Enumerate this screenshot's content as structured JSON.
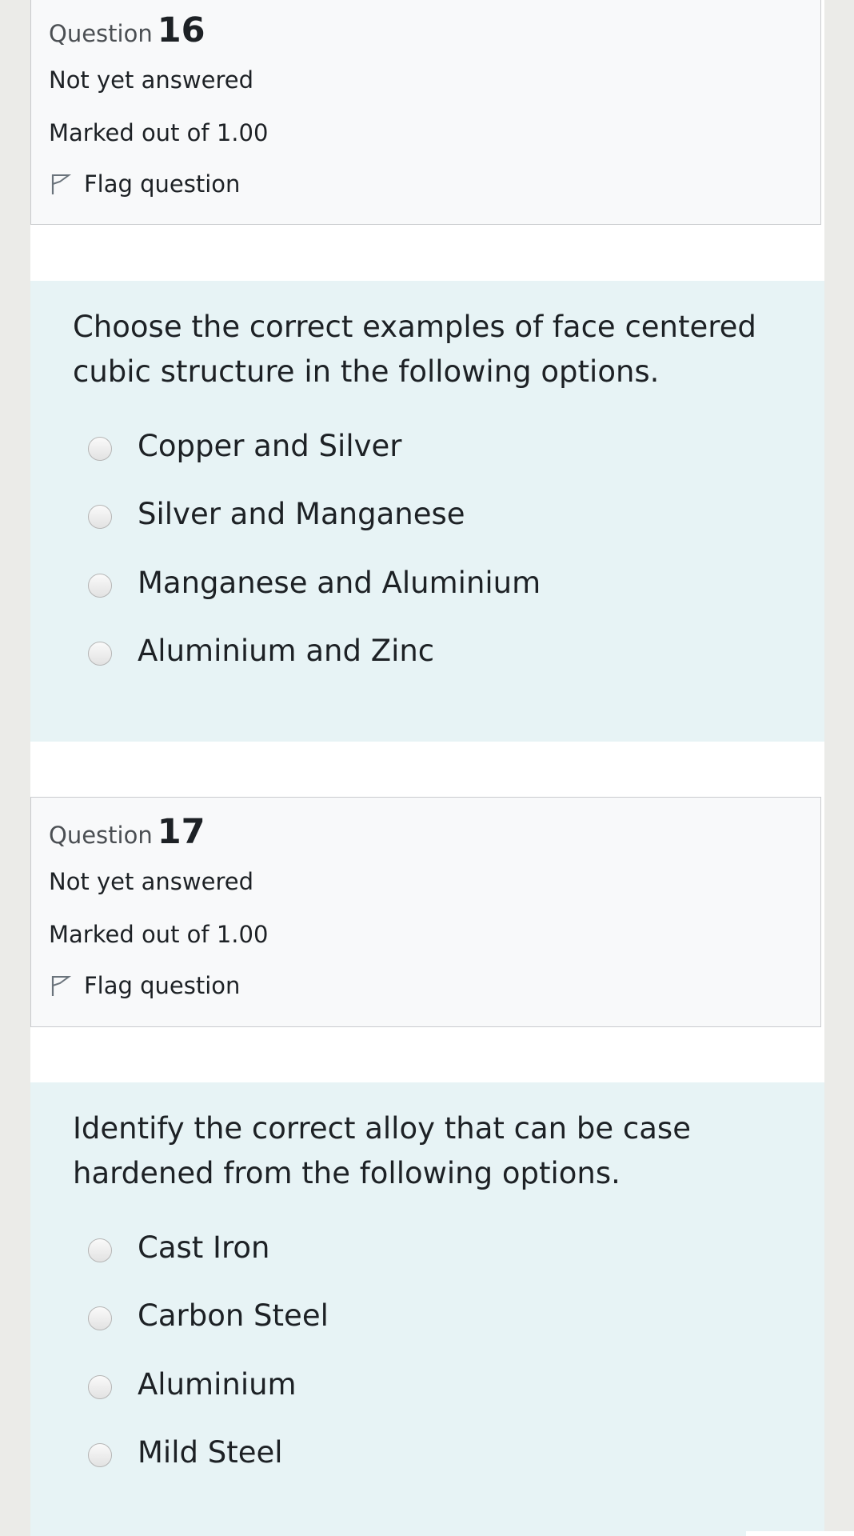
{
  "questions": [
    {
      "label": "Question",
      "number": "16",
      "state": "Not yet answered",
      "grade": "Marked out of 1.00",
      "flag_label": "Flag question",
      "text": "Choose the correct examples of face centered cubic structure in the following options.",
      "options": [
        {
          "label": "Copper and Silver"
        },
        {
          "label": "Silver and Manganese"
        },
        {
          "label": "Manganese and Aluminium"
        },
        {
          "label": "Aluminium and Zinc"
        }
      ]
    },
    {
      "label": "Question",
      "number": "17",
      "state": "Not yet answered",
      "grade": "Marked out of 1.00",
      "flag_label": "Flag question",
      "text": "Identify the correct alloy that can be case hardened from the following options.",
      "options": [
        {
          "label": "Cast Iron"
        },
        {
          "label": "Carbon Steel"
        },
        {
          "label": "Aluminium"
        },
        {
          "label": "Mild Steel"
        }
      ]
    }
  ],
  "colors": {
    "page_bg": "#ebebe8",
    "info_bg": "#f8f9fa",
    "content_bg": "#e7f3f5",
    "text": "#1d2125"
  },
  "icons": {
    "flag": "flag-outline-icon",
    "radio": "radio-unchecked-icon"
  }
}
